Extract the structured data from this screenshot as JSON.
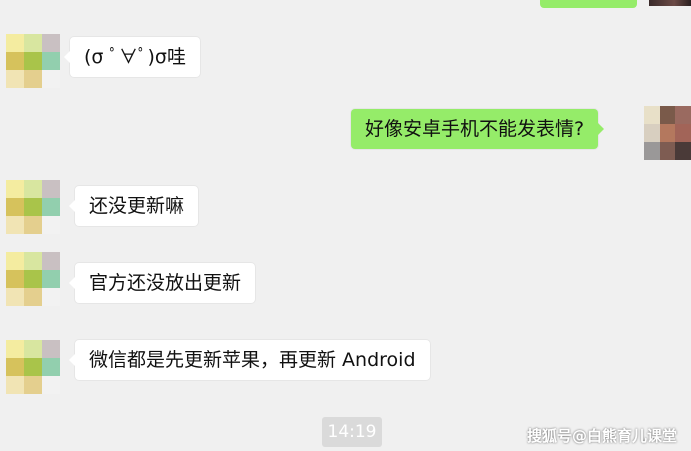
{
  "messages": [
    {
      "id": "m1",
      "side": "left",
      "text": "(σ ﾟ∀ﾟ)σ哇"
    },
    {
      "id": "m2",
      "side": "right",
      "text": "好像安卓手机不能发表情?"
    },
    {
      "id": "m3",
      "side": "left",
      "text": "还没更新嘛"
    },
    {
      "id": "m4",
      "side": "left",
      "text": "官方还没放出更新"
    },
    {
      "id": "m5",
      "side": "left",
      "text": "微信都是先更新苹果，再更新 Android"
    }
  ],
  "timestamp": "14:19",
  "watermark": "搜狐号@白熊育儿课堂",
  "colors": {
    "background": "#f0f0f0",
    "incoming_bubble": "#ffffff",
    "outgoing_bubble": "#95ec69",
    "timestamp_badge": "#dadada"
  },
  "avatars": {
    "contact": [
      "#f4eca0",
      "#d8e6a0",
      "#c9c0c2",
      "#d6c25c",
      "#a9c44a",
      "#92cfae",
      "#f1e4b4",
      "#e4cf8e",
      "#f2f2f2"
    ],
    "self": [
      "#e8e0c8",
      "#7a5a4a",
      "#9a6a60",
      "#d8cfc0",
      "#b4785e",
      "#a26458",
      "#9a9898",
      "#7e5c52",
      "#4a3a38"
    ]
  }
}
